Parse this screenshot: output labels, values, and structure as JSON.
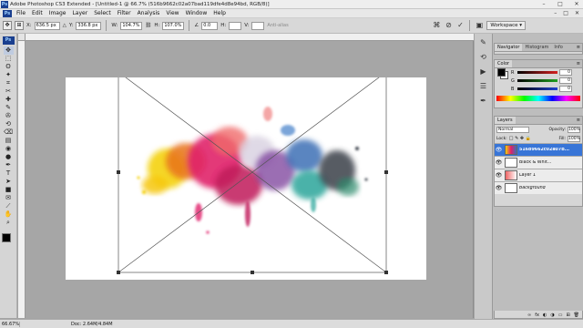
{
  "title_bar": {
    "title": "Adobe Photoshop CS3 Extended - [Untitled-1 @ 66.7% (516b9662c02a07bad119dfe4d8e94bd, RGB/8)]",
    "minimize": "–",
    "maximize": "□",
    "close": "✕"
  },
  "menu": [
    "File",
    "Edit",
    "Image",
    "Layer",
    "Select",
    "Filter",
    "Analysis",
    "View",
    "Window",
    "Help"
  ],
  "menu_right": [
    "–",
    "□",
    "✕"
  ],
  "options": {
    "x_label": "X:",
    "x_value": "636.5 px",
    "y_label": "Y:",
    "y_value": "336.8 px",
    "w_label": "W:",
    "w_value": "104.7%",
    "h_label": "H:",
    "h_value": "107.0%",
    "angle_value": "0.0",
    "h_skew": "H:",
    "v_skew": "V:",
    "antialias": "Anti-alias",
    "workspace": "Workspace ▾"
  },
  "tools": {
    "badge": "Ps",
    "icons": [
      "move-icon",
      "marquee-icon",
      "lasso-icon",
      "magic-wand-icon",
      "crop-icon",
      "slice-icon",
      "healing-icon",
      "brush-icon",
      "clone-stamp-icon",
      "history-brush-icon",
      "eraser-icon",
      "gradient-icon",
      "blur-icon",
      "dodge-icon",
      "pen-icon",
      "type-icon",
      "path-select-icon",
      "shape-icon",
      "notes-icon",
      "eyedropper-icon",
      "hand-icon",
      "zoom-icon"
    ],
    "glyphs": [
      "✥",
      "⬚",
      "ʘ",
      "✦",
      "⌗",
      "✂",
      "✚",
      "✎",
      "✇",
      "⟲",
      "⌫",
      "▤",
      "◉",
      "●",
      "✒",
      "T",
      "➤",
      "■",
      "✉",
      "⟋",
      "✋",
      "⌕"
    ]
  },
  "panels": {
    "navigator_tabs": [
      "Navigator",
      "Histogram",
      "Info"
    ],
    "color_tab": "Color",
    "color_channels": [
      {
        "ch": "R",
        "value": "0",
        "color": "#d42020"
      },
      {
        "ch": "G",
        "value": "0",
        "color": "#20a020"
      },
      {
        "ch": "B",
        "value": "0",
        "color": "#2040d0"
      }
    ],
    "layers_tab": "Layers",
    "blend_mode": "Normal",
    "opacity_label": "Opacity:",
    "opacity_value": "100%",
    "lock_label": "Lock:",
    "fill_label": "Fill:",
    "fill_value": "100%",
    "layers": [
      {
        "name": "516b9662c02a07b...",
        "selected": true
      },
      {
        "name": "Black & Whit...",
        "selected": false
      },
      {
        "name": "Layer 1",
        "selected": false
      },
      {
        "name": "Background",
        "selected": false
      }
    ],
    "footer_icons": [
      "∞",
      "fx",
      "◐",
      "◑",
      "▭",
      "⊞",
      "🗑"
    ]
  },
  "status": {
    "zoom": "66.67%",
    "doc": "Doc: 2.64M/4.84M"
  },
  "colors": {
    "selection_blue": "#3875d7",
    "canvas": "#ffffff",
    "workspace_bg": "#a6a6a6"
  }
}
